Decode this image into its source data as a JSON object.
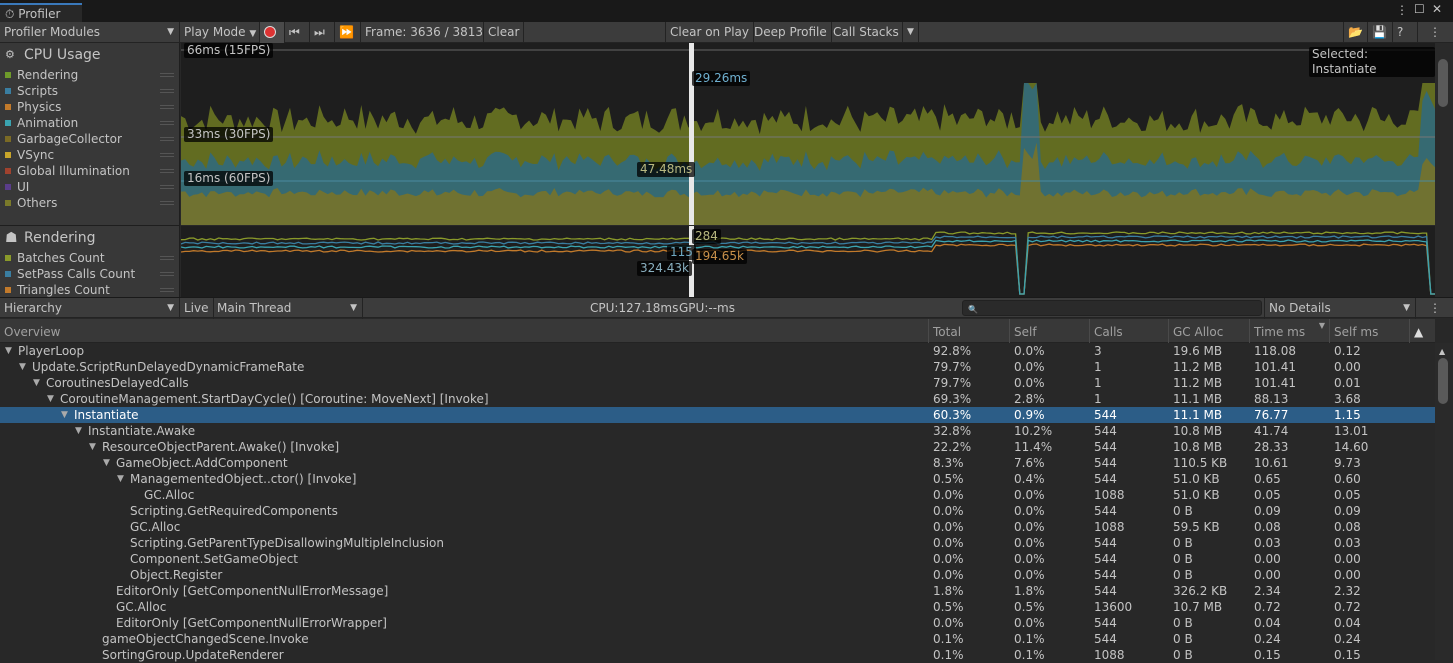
{
  "window": {
    "tab_title": "Profiler"
  },
  "toolbar": {
    "modules": "Profiler Modules",
    "play_mode": "Play Mode",
    "frame": "Frame: 3636 / 3813",
    "clear": "Clear",
    "clear_on_play": "Clear on Play",
    "deep_profile": "Deep Profile",
    "call_stacks": "Call Stacks"
  },
  "cpu": {
    "title": "CPU Usage",
    "legend": [
      {
        "label": "Rendering",
        "color": "#6e9a2a"
      },
      {
        "label": "Scripts",
        "color": "#3a7ea1"
      },
      {
        "label": "Physics",
        "color": "#c27a2b"
      },
      {
        "label": "Animation",
        "color": "#3aa3b0"
      },
      {
        "label": "GarbageCollector",
        "color": "#7a6a25"
      },
      {
        "label": "VSync",
        "color": "#c8a52a"
      },
      {
        "label": "Global Illumination",
        "color": "#a0422e"
      },
      {
        "label": "UI",
        "color": "#5a3d8a"
      },
      {
        "label": "Others",
        "color": "#7a7a2a"
      }
    ],
    "lines": [
      "66ms (15FPS)",
      "33ms (30FPS)",
      "16ms (60FPS)"
    ],
    "selected_label": "Selected: Instantiate",
    "value_top": "29.26ms",
    "value_total": "47.48ms"
  },
  "rendering": {
    "title": "Rendering",
    "legend": [
      {
        "label": "Batches Count",
        "color": "#8a9a2a"
      },
      {
        "label": "SetPass Calls Count",
        "color": "#3a7ea1"
      },
      {
        "label": "Triangles Count",
        "color": "#c27a2b"
      }
    ],
    "values": [
      "284",
      "115",
      "194.65k",
      "324.43k"
    ]
  },
  "hierarchy": {
    "view": "Hierarchy",
    "live": "Live",
    "thread": "Main Thread",
    "cpu": "CPU:127.18ms",
    "gpu": "GPU:--ms",
    "search_placeholder": "",
    "details": "No Details",
    "columns": [
      "Overview",
      "Total",
      "Self",
      "Calls",
      "GC Alloc",
      "Time ms",
      "Self ms"
    ],
    "rows": [
      {
        "name": "PlayerLoop",
        "depth": 0,
        "arrow": "▼",
        "total": "92.8%",
        "self": "0.0%",
        "calls": "3",
        "gc": "19.6 MB",
        "time": "118.08",
        "selfms": "0.12"
      },
      {
        "name": "Update.ScriptRunDelayedDynamicFrameRate",
        "depth": 1,
        "arrow": "▼",
        "total": "79.7%",
        "self": "0.0%",
        "calls": "1",
        "gc": "11.2 MB",
        "time": "101.41",
        "selfms": "0.00"
      },
      {
        "name": "CoroutinesDelayedCalls",
        "depth": 2,
        "arrow": "▼",
        "total": "79.7%",
        "self": "0.0%",
        "calls": "1",
        "gc": "11.2 MB",
        "time": "101.41",
        "selfms": "0.01"
      },
      {
        "name": "CoroutineManagement.StartDayCycle() [Coroutine: MoveNext] [Invoke]",
        "depth": 3,
        "arrow": "▼",
        "total": "69.3%",
        "self": "2.8%",
        "calls": "1",
        "gc": "11.1 MB",
        "time": "88.13",
        "selfms": "3.68"
      },
      {
        "name": "Instantiate",
        "depth": 4,
        "arrow": "▼",
        "selected": true,
        "total": "60.3%",
        "self": "0.9%",
        "calls": "544",
        "gc": "11.1 MB",
        "time": "76.77",
        "selfms": "1.15"
      },
      {
        "name": "Instantiate.Awake",
        "depth": 5,
        "arrow": "▼",
        "total": "32.8%",
        "self": "10.2%",
        "calls": "544",
        "gc": "10.8 MB",
        "time": "41.74",
        "selfms": "13.01"
      },
      {
        "name": "ResourceObjectParent.Awake() [Invoke]",
        "depth": 6,
        "arrow": "▼",
        "total": "22.2%",
        "self": "11.4%",
        "calls": "544",
        "gc": "10.8 MB",
        "time": "28.33",
        "selfms": "14.60"
      },
      {
        "name": "GameObject.AddComponent",
        "depth": 7,
        "arrow": "▼",
        "total": "8.3%",
        "self": "7.6%",
        "calls": "544",
        "gc": "110.5 KB",
        "time": "10.61",
        "selfms": "9.73"
      },
      {
        "name": "ManagementedObject..ctor() [Invoke]",
        "depth": 8,
        "arrow": "▼",
        "total": "0.5%",
        "self": "0.4%",
        "calls": "544",
        "gc": "51.0 KB",
        "time": "0.65",
        "selfms": "0.60"
      },
      {
        "name": "GC.Alloc",
        "depth": 9,
        "arrow": "",
        "total": "0.0%",
        "self": "0.0%",
        "calls": "1088",
        "gc": "51.0 KB",
        "time": "0.05",
        "selfms": "0.05"
      },
      {
        "name": "Scripting.GetRequiredComponents",
        "depth": 8,
        "arrow": "",
        "total": "0.0%",
        "self": "0.0%",
        "calls": "544",
        "gc": "0 B",
        "time": "0.09",
        "selfms": "0.09"
      },
      {
        "name": "GC.Alloc",
        "depth": 8,
        "arrow": "",
        "total": "0.0%",
        "self": "0.0%",
        "calls": "1088",
        "gc": "59.5 KB",
        "time": "0.08",
        "selfms": "0.08"
      },
      {
        "name": "Scripting.GetParentTypeDisallowingMultipleInclusion",
        "depth": 8,
        "arrow": "",
        "total": "0.0%",
        "self": "0.0%",
        "calls": "544",
        "gc": "0 B",
        "time": "0.03",
        "selfms": "0.03"
      },
      {
        "name": "Component.SetGameObject",
        "depth": 8,
        "arrow": "",
        "total": "0.0%",
        "self": "0.0%",
        "calls": "544",
        "gc": "0 B",
        "time": "0.00",
        "selfms": "0.00"
      },
      {
        "name": "Object.Register",
        "depth": 8,
        "arrow": "",
        "total": "0.0%",
        "self": "0.0%",
        "calls": "544",
        "gc": "0 B",
        "time": "0.00",
        "selfms": "0.00"
      },
      {
        "name": "EditorOnly [GetComponentNullErrorMessage]",
        "depth": 7,
        "arrow": "",
        "total": "1.8%",
        "self": "1.8%",
        "calls": "544",
        "gc": "326.2 KB",
        "time": "2.34",
        "selfms": "2.32"
      },
      {
        "name": "GC.Alloc",
        "depth": 7,
        "arrow": "",
        "total": "0.5%",
        "self": "0.5%",
        "calls": "13600",
        "gc": "10.7 MB",
        "time": "0.72",
        "selfms": "0.72"
      },
      {
        "name": "EditorOnly [GetComponentNullErrorWrapper]",
        "depth": 7,
        "arrow": "",
        "total": "0.0%",
        "self": "0.0%",
        "calls": "544",
        "gc": "0 B",
        "time": "0.04",
        "selfms": "0.04"
      },
      {
        "name": "gameObjectChangedScene.Invoke",
        "depth": 6,
        "arrow": "",
        "total": "0.1%",
        "self": "0.1%",
        "calls": "544",
        "gc": "0 B",
        "time": "0.24",
        "selfms": "0.24"
      },
      {
        "name": "SortingGroup.UpdateRenderer",
        "depth": 6,
        "arrow": "",
        "total": "0.1%",
        "self": "0.1%",
        "calls": "1088",
        "gc": "0 B",
        "time": "0.15",
        "selfms": "0.15"
      }
    ]
  }
}
